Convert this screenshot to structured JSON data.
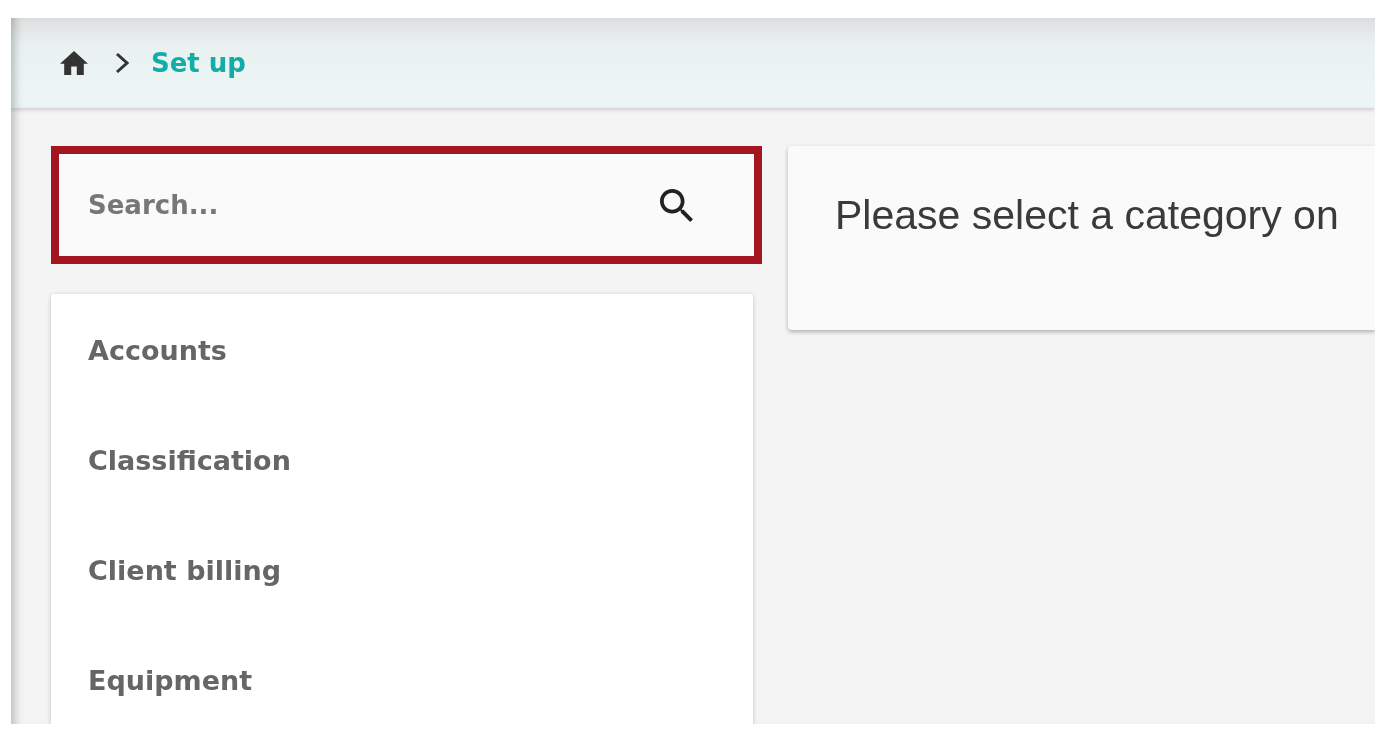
{
  "breadcrumb": {
    "current": "Set up"
  },
  "search": {
    "placeholder": "Search...",
    "highlighted": true
  },
  "categories": [
    {
      "label": "Accounts",
      "selected": false
    },
    {
      "label": "Classification",
      "selected": false
    },
    {
      "label": "Client billing",
      "selected": false
    },
    {
      "label": "Equipment",
      "selected": false
    }
  ],
  "message": "Please select a category on"
}
